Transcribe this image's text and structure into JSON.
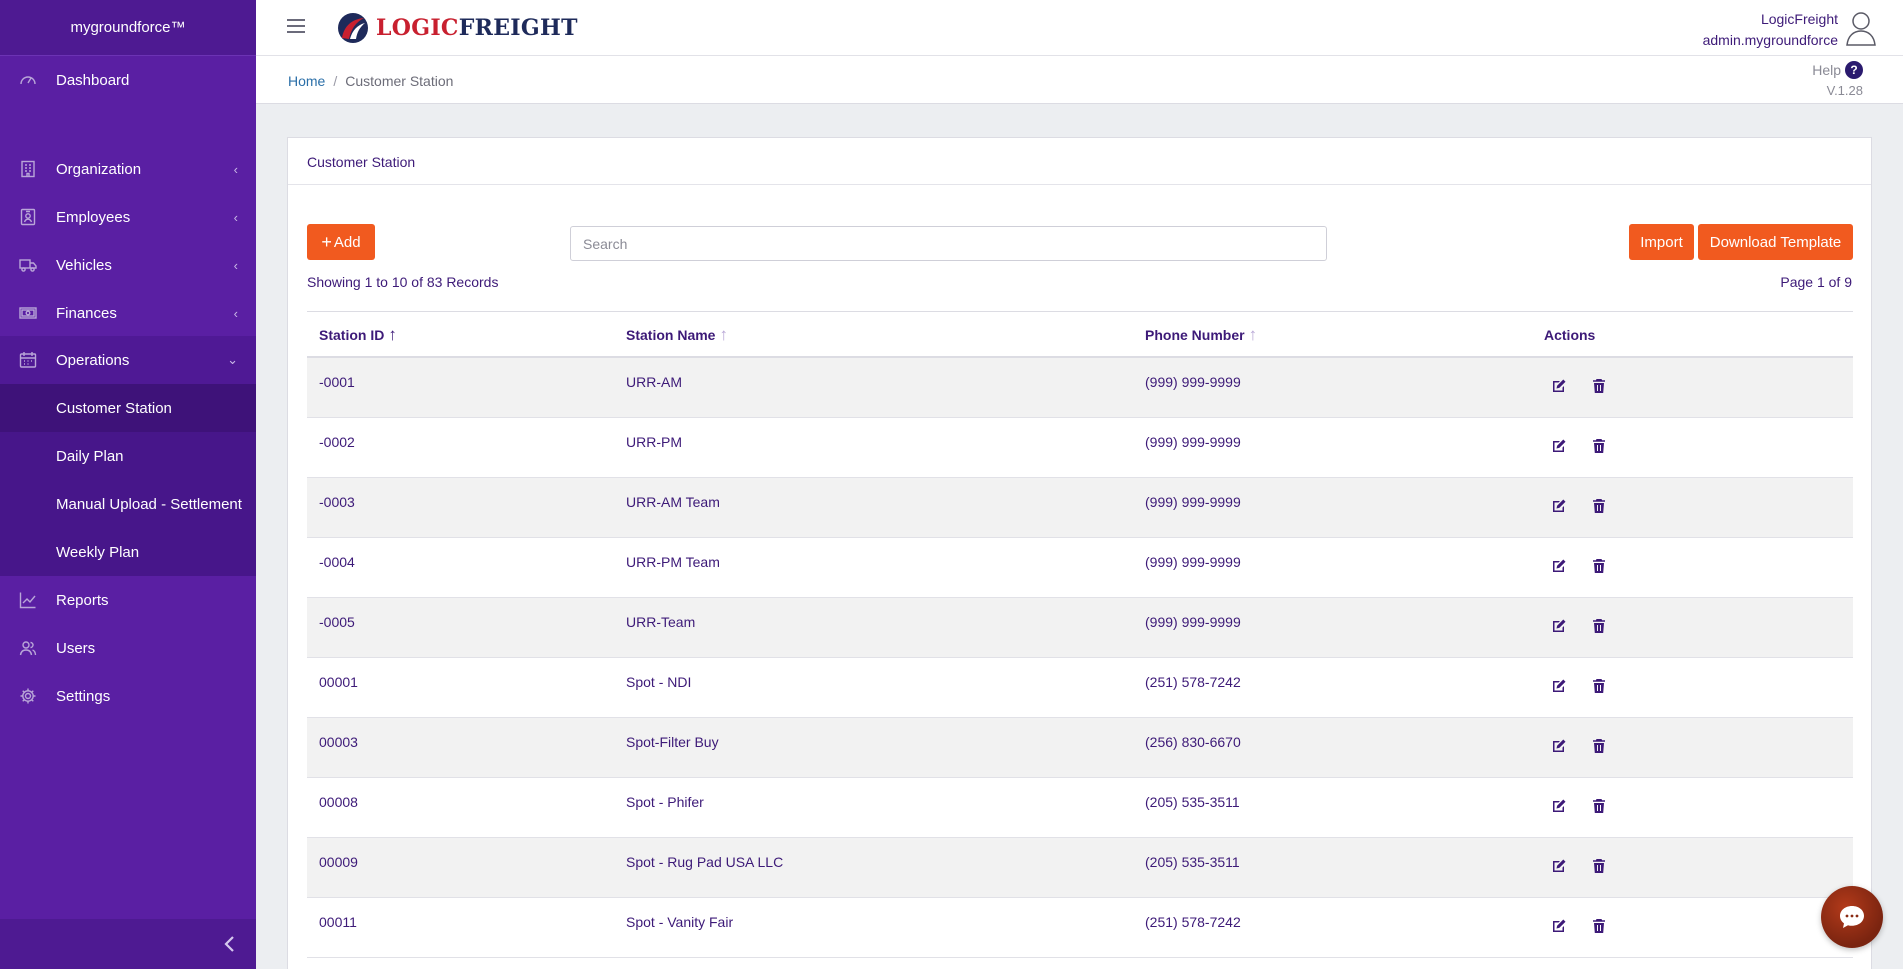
{
  "app": {
    "brand": "mygroundforce™"
  },
  "sidebar": {
    "items": [
      {
        "label": "Dashboard",
        "icon": "dashboard-gauge-icon"
      },
      {
        "label": "Organization",
        "icon": "building-icon"
      },
      {
        "label": "Employees",
        "icon": "id-badge-icon"
      },
      {
        "label": "Vehicles",
        "icon": "truck-icon"
      },
      {
        "label": "Finances",
        "icon": "money-icon"
      },
      {
        "label": "Operations",
        "icon": "calendar-icon"
      },
      {
        "label": "Reports",
        "icon": "line-chart-icon"
      },
      {
        "label": "Users",
        "icon": "users-icon"
      },
      {
        "label": "Settings",
        "icon": "gear-icon"
      }
    ],
    "operations_sub": [
      {
        "label": "Customer Station"
      },
      {
        "label": "Daily Plan"
      },
      {
        "label": "Manual Upload - Settlement"
      },
      {
        "label": "Weekly Plan"
      }
    ]
  },
  "header": {
    "logo_text_1": "LOGIC",
    "logo_text_2": "FREIGHT",
    "company": "LogicFreight",
    "username": "admin.mygroundforce"
  },
  "breadcrumb": {
    "home": "Home",
    "separator": "/",
    "current": "Customer Station"
  },
  "help": {
    "label": "Help",
    "icon_text": "?",
    "version": "V.1.28"
  },
  "card": {
    "title": "Customer Station",
    "add_label": "Add",
    "import_label": "Import",
    "download_label": "Download Template",
    "search_placeholder": "Search",
    "records_text": "Showing 1 to 10 of 83 Records",
    "page_text": "Page 1 of 9"
  },
  "table": {
    "columns": [
      "Station ID",
      "Station Name",
      "Phone Number",
      "Actions"
    ],
    "rows": [
      {
        "id": "-0001",
        "name": "URR-AM",
        "phone": "(999) 999-9999"
      },
      {
        "id": "-0002",
        "name": "URR-PM",
        "phone": "(999) 999-9999"
      },
      {
        "id": "-0003",
        "name": "URR-AM Team",
        "phone": "(999) 999-9999"
      },
      {
        "id": "-0004",
        "name": "URR-PM Team",
        "phone": "(999) 999-9999"
      },
      {
        "id": "-0005",
        "name": "URR-Team",
        "phone": "(999) 999-9999"
      },
      {
        "id": "00001",
        "name": "Spot - NDI",
        "phone": "(251) 578-7242"
      },
      {
        "id": "00003",
        "name": "Spot-Filter Buy",
        "phone": "(256) 830-6670"
      },
      {
        "id": "00008",
        "name": "Spot - Phifer",
        "phone": "(205) 535-3511"
      },
      {
        "id": "00009",
        "name": "Spot - Rug Pad USA LLC",
        "phone": "(205) 535-3511"
      },
      {
        "id": "00011",
        "name": "Spot - Vanity Fair",
        "phone": "(251) 578-7242"
      }
    ]
  },
  "colors": {
    "sidebar": "#5a1fa3",
    "accent": "#f15a1f",
    "text": "#3d1a78"
  }
}
